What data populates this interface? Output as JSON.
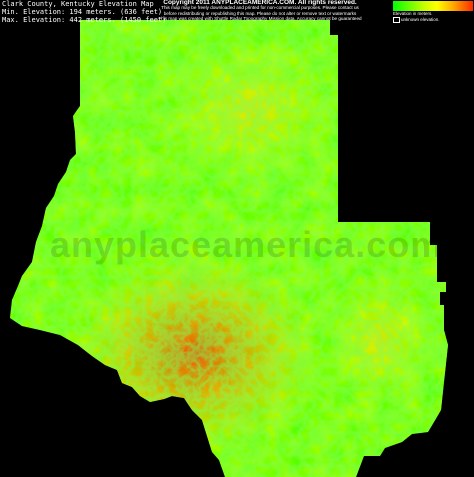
{
  "header": {
    "title": "Clark County, Kentucky Elevation Map",
    "min_elevation": "Min. Elevation: 194 meters. (636 feet)",
    "max_elevation": "Max. Elevation: 442 meters. (1450 feet)",
    "copyright": "Copyright 2011 ANYPLACEAMERICA.COM.  All rights reserved.",
    "notice_1": "This map may be freely downloaded and printed for non-commercial purposes. Please contact us",
    "notice_2": "before redistributing or republishing this map. Please do not alter or remove text or watermarks",
    "notice_3": "This map was created with Shuttle Radar Topography Mission data. Accuracy cannot be guaranteed"
  },
  "legend": {
    "ticks": [
      "",
      "",
      "",
      "",
      "",
      "",
      "",
      ""
    ],
    "elevation_label": "Elevation in meters.",
    "unknown_label": "unknown elevation.",
    "colors": [
      "#00ff00",
      "#66ff00",
      "#ccff00",
      "#ffff00",
      "#ffaa00",
      "#ff2a00"
    ]
  },
  "map": {
    "watermark": "anyplaceamerica.com",
    "background": "#000000",
    "low_color": "#33ff00",
    "mid_color": "#eeff00",
    "high_color": "#ff3300"
  }
}
